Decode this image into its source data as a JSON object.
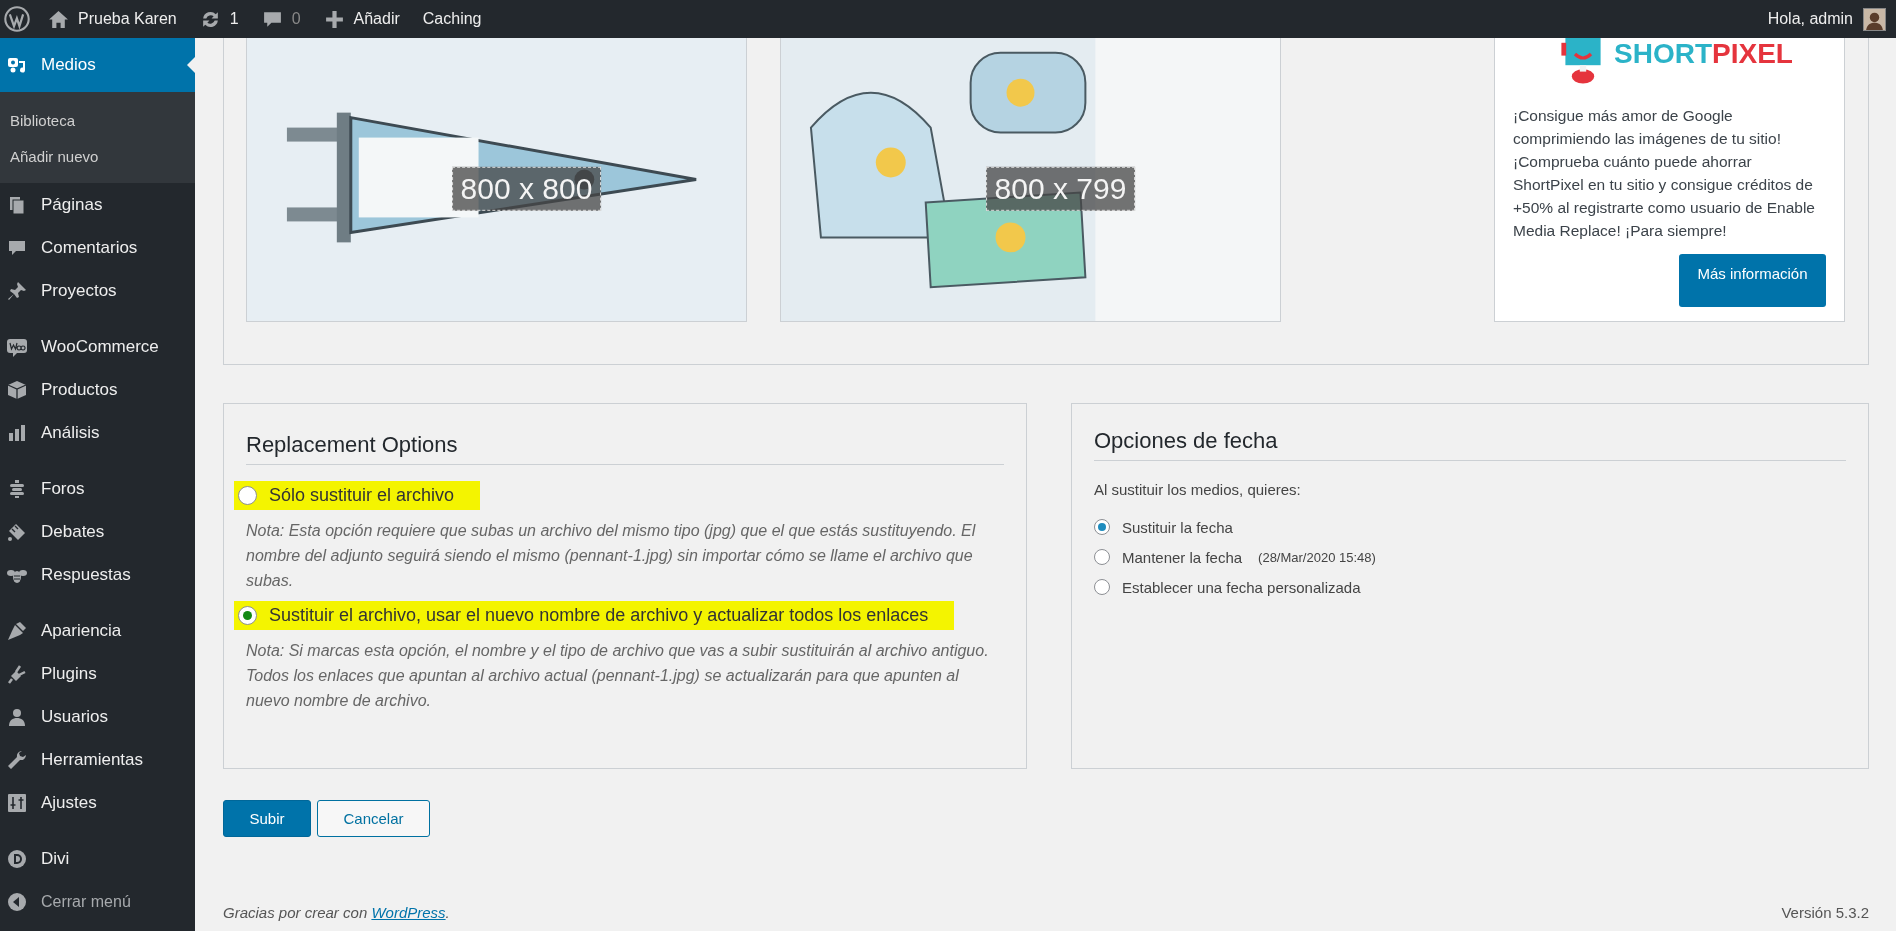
{
  "admin_bar": {
    "site_name": "Prueba Karen",
    "updates": "1",
    "comments": "0",
    "add_new": "Añadir",
    "caching": "Caching",
    "greeting": "Hola, admin"
  },
  "sidebar": {
    "groups": [
      [
        {
          "label": "Medios",
          "kind": "media",
          "selected": true,
          "children": [
            {
              "label": "Biblioteca"
            },
            {
              "label": "Añadir nuevo"
            }
          ]
        },
        {
          "label": "Páginas",
          "kind": "pages",
          "selected": false
        },
        {
          "label": "Comentarios",
          "kind": "comments",
          "selected": false
        },
        {
          "label": "Proyectos",
          "kind": "pin",
          "selected": false
        }
      ],
      [
        {
          "label": "WooCommerce",
          "kind": "woo",
          "selected": false
        },
        {
          "label": "Productos",
          "kind": "box",
          "selected": false
        },
        {
          "label": "Análisis",
          "kind": "chart",
          "selected": false
        }
      ],
      [
        {
          "label": "Foros",
          "kind": "forum",
          "selected": false
        },
        {
          "label": "Debates",
          "kind": "topics",
          "selected": false
        },
        {
          "label": "Respuestas",
          "kind": "bee",
          "selected": false
        }
      ],
      [
        {
          "label": "Apariencia",
          "kind": "brush",
          "selected": false
        },
        {
          "label": "Plugins",
          "kind": "plug",
          "selected": false
        },
        {
          "label": "Usuarios",
          "kind": "user",
          "selected": false
        },
        {
          "label": "Herramientas",
          "kind": "wrench",
          "selected": false
        },
        {
          "label": "Ajustes",
          "kind": "sliders",
          "selected": false
        }
      ],
      [
        {
          "label": "Divi",
          "kind": "divi",
          "selected": false
        },
        {
          "label": "Cerrar menú",
          "kind": "collapse",
          "selected": false
        }
      ]
    ]
  },
  "previews": [
    {
      "kind": "pennant",
      "dimensions": "800 x 800"
    },
    {
      "kind": "clothes",
      "dimensions": "800 x 799"
    }
  ],
  "promo": {
    "brand_first": "SHORT",
    "brand_second": "PIXEL",
    "text": "¡Consigue más amor de Google comprimiendo las imágenes de tu sitio! ¡Comprueba cuánto puede ahorrar ShortPixel en tu sitio y consigue créditos de +50% al registrarte como usuario de Enable Media Replace! ¡Para siempre!",
    "button": "Más información"
  },
  "replacement": {
    "title": "Replacement Options",
    "options": [
      {
        "label": "Sólo sustituir el archivo",
        "selected": false,
        "highlighted": true,
        "note": "Nota: Esta opción requiere que subas un archivo del mismo tipo (jpg) que el que estás sustituyendo. El nombre del adjunto seguirá siendo el mismo (pennant-1.jpg) sin importar cómo se llame el archivo que subas."
      },
      {
        "label": "Sustituir el archivo, usar el nuevo nombre de archivo y actualizar todos los enlaces",
        "selected": true,
        "highlighted": true,
        "note": "Nota: Si marcas esta opción, el nombre y el tipo de archivo que vas a subir sustituirán al archivo antiguo. Todos los enlaces que apuntan al archivo actual (pennant-1.jpg) se actualizarán para que apunten al nuevo nombre de archivo."
      }
    ]
  },
  "date_options": {
    "title": "Opciones de fecha",
    "intro": "Al sustituir los medios, quieres:",
    "options": [
      {
        "label": "Sustituir la fecha",
        "selected": true
      },
      {
        "label": "Mantener la fecha",
        "selected": false,
        "hint": "(28/Mar/2020 15:48)"
      },
      {
        "label": "Establecer una fecha personalizada",
        "selected": false
      }
    ]
  },
  "buttons": {
    "primary": "Subir",
    "secondary": "Cancelar"
  },
  "footer": {
    "credit_before": "Gracias por crear con ",
    "credit_link": "WordPress",
    "credit_after": ".",
    "version": "Versión 5.3.2"
  }
}
